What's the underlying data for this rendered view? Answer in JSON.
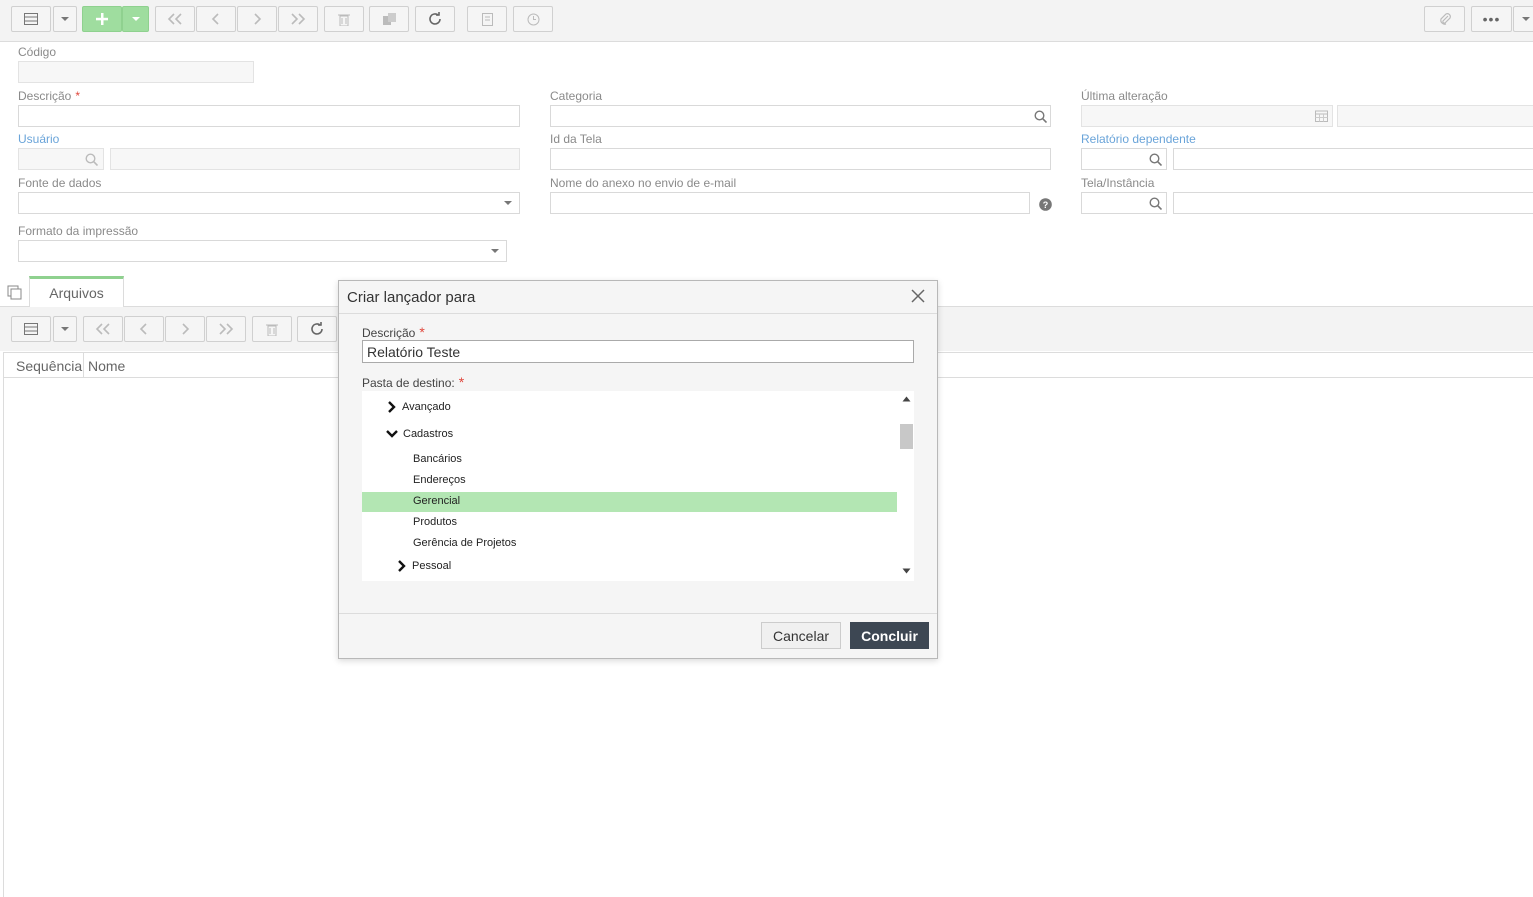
{
  "form": {
    "codigo_label": "Código",
    "descricao_label": "Descrição",
    "categoria_label": "Categoria",
    "ultima_alteracao_label": "Última alteração",
    "usuario_label": "Usuário",
    "id_tela_label": "Id da Tela",
    "relatorio_dependente_label": "Relatório dependente",
    "fonte_dados_label": "Fonte de dados",
    "nome_anexo_label": "Nome do anexo no envio de e-mail",
    "tela_instancia_label": "Tela/Instância",
    "formato_impressao_label": "Formato da impressão",
    "required_mark": "*"
  },
  "tabs": {
    "arquivos": "Arquivos"
  },
  "grid": {
    "columns": [
      "Sequência",
      "Nome"
    ]
  },
  "dialog": {
    "title": "Criar lançador para",
    "descricao_label": "Descrição",
    "descricao_value": "Relatório Teste",
    "pasta_label": "Pasta de destino:",
    "tree": [
      {
        "label": "Avançado",
        "expanded": false,
        "level": 1
      },
      {
        "label": "Cadastros",
        "expanded": true,
        "level": 1
      },
      {
        "label": "Bancários",
        "level": 2
      },
      {
        "label": "Endereços",
        "level": 2
      },
      {
        "label": "Gerencial",
        "level": 2,
        "selected": true
      },
      {
        "label": "Produtos",
        "level": 2
      },
      {
        "label": "Gerência de Projetos",
        "level": 2
      },
      {
        "label": "Pessoal",
        "expanded": false,
        "level": 1
      }
    ],
    "cancel_label": "Cancelar",
    "ok_label": "Concluir"
  },
  "colors": {
    "accent_green": "#9fdd9f",
    "selection": "#b3e6b3",
    "link_blue": "#6aa4d9",
    "primary_button": "#3d4753",
    "required": "#e0463b"
  }
}
